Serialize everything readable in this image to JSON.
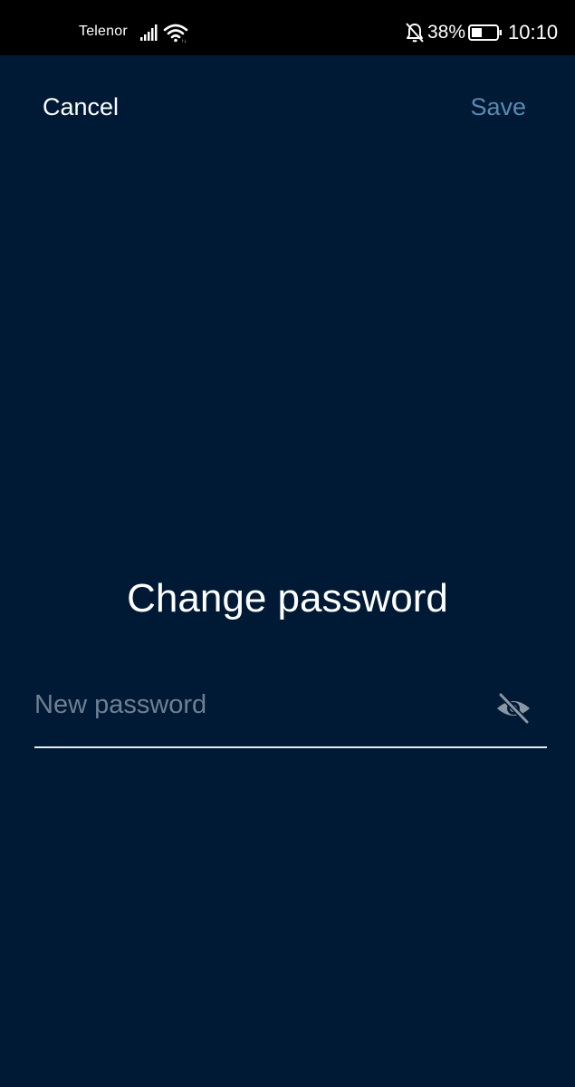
{
  "status_bar": {
    "carrier": "Telenor",
    "battery_percent": "38%",
    "time": "10:10",
    "icons": [
      "signal-icon",
      "wifi-icon",
      "bell-off-icon",
      "battery-icon"
    ]
  },
  "header": {
    "cancel_label": "Cancel",
    "save_label": "Save"
  },
  "main": {
    "title": "Change password",
    "password_field": {
      "value": "",
      "placeholder": "New password",
      "visibility_icon": "eye-off-icon"
    }
  },
  "colors": {
    "background": "#001a35",
    "status_bar": "#000000",
    "text_primary": "#ffffff",
    "save_disabled": "#5b89b3",
    "placeholder": "#6f7f92",
    "field_underline": "#e6ebf0"
  }
}
